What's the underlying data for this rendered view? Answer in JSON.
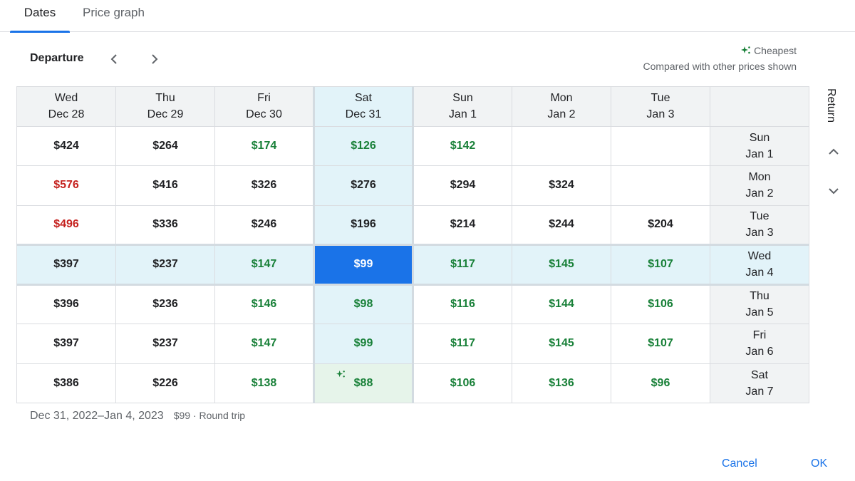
{
  "tabs": [
    {
      "label": "Dates",
      "active": true
    },
    {
      "label": "Price graph",
      "active": false
    }
  ],
  "departure": {
    "label": "Departure",
    "prev_icon": "chevron-left-icon",
    "next_icon": "chevron-right-icon"
  },
  "legend": {
    "icon": "sparkle-icon",
    "cheapest_label": "Cheapest",
    "note": "Compared with other prices shown"
  },
  "return_axis": {
    "label": "Return",
    "up_icon": "chevron-up-icon",
    "down_icon": "chevron-down-icon"
  },
  "columns": [
    {
      "day": "Wed",
      "date": "Dec 28"
    },
    {
      "day": "Thu",
      "date": "Dec 29"
    },
    {
      "day": "Fri",
      "date": "Dec 30"
    },
    {
      "day": "Sat",
      "date": "Dec 31",
      "selected": true
    },
    {
      "day": "Sun",
      "date": "Jan 1"
    },
    {
      "day": "Mon",
      "date": "Jan 2"
    },
    {
      "day": "Tue",
      "date": "Jan 3"
    }
  ],
  "rows": [
    {
      "day": "Sun",
      "date": "Jan 1",
      "prices": [
        "$424",
        "$264",
        "$174",
        "$126",
        "$142",
        "",
        ""
      ],
      "tones": [
        "n",
        "n",
        "g",
        "g",
        "g",
        "",
        ""
      ]
    },
    {
      "day": "Mon",
      "date": "Jan 2",
      "prices": [
        "$576",
        "$416",
        "$326",
        "$276",
        "$294",
        "$324",
        ""
      ],
      "tones": [
        "r",
        "n",
        "n",
        "n",
        "n",
        "n",
        ""
      ]
    },
    {
      "day": "Tue",
      "date": "Jan 3",
      "prices": [
        "$496",
        "$336",
        "$246",
        "$196",
        "$214",
        "$244",
        "$204"
      ],
      "tones": [
        "r",
        "n",
        "n",
        "n",
        "n",
        "n",
        "n"
      ]
    },
    {
      "day": "Wed",
      "date": "Jan 4",
      "selected": true,
      "prices": [
        "$397",
        "$237",
        "$147",
        "$99",
        "$117",
        "$145",
        "$107"
      ],
      "tones": [
        "n",
        "n",
        "g",
        "g",
        "g",
        "g",
        "g"
      ]
    },
    {
      "day": "Thu",
      "date": "Jan 5",
      "prices": [
        "$396",
        "$236",
        "$146",
        "$98",
        "$116",
        "$144",
        "$106"
      ],
      "tones": [
        "n",
        "n",
        "g",
        "g",
        "g",
        "g",
        "g"
      ]
    },
    {
      "day": "Fri",
      "date": "Jan 6",
      "prices": [
        "$397",
        "$237",
        "$147",
        "$99",
        "$117",
        "$145",
        "$107"
      ],
      "tones": [
        "n",
        "n",
        "g",
        "g",
        "g",
        "g",
        "g"
      ]
    },
    {
      "day": "Sat",
      "date": "Jan 7",
      "prices": [
        "$386",
        "$226",
        "$138",
        "$88",
        "$106",
        "$136",
        "$96"
      ],
      "tones": [
        "n",
        "n",
        "g",
        "g",
        "g",
        "g",
        "g"
      ],
      "cheapest_index": 3
    }
  ],
  "summary": {
    "range": "Dec 31, 2022–Jan 4, 2023",
    "price": "$99 · Round trip"
  },
  "actions": {
    "cancel": "Cancel",
    "ok": "OK"
  },
  "colors": {
    "accent": "#1a73e8",
    "cheap_green": "#188038",
    "expensive_red": "#c5221f",
    "highlight": "#e2f3f9",
    "cheapest_bg": "#e6f4ea"
  }
}
